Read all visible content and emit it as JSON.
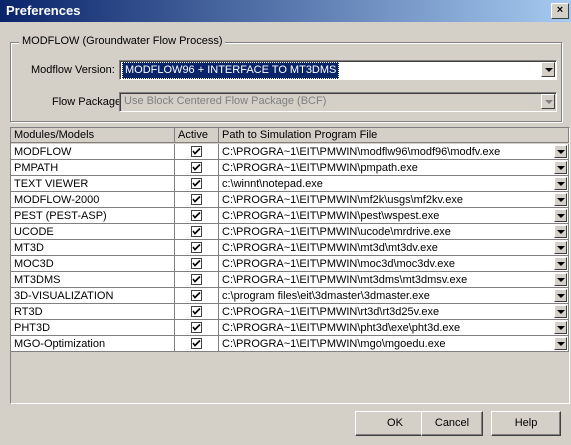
{
  "window": {
    "title": "Preferences",
    "close_label": "×"
  },
  "group": {
    "title": "MODFLOW (Groundwater Flow Process)"
  },
  "modflow_version": {
    "label": "Modflow Version:",
    "value": "MODFLOW96 + INTERFACE TO MT3DMS"
  },
  "flow_package": {
    "label": "Flow Package:",
    "value": "Use Block Centered Flow Package (BCF)"
  },
  "table": {
    "headers": [
      "Modules/Models",
      "Active",
      "Path to Simulation Program File"
    ],
    "rows": [
      {
        "name": "MODFLOW",
        "active": true,
        "path": "C:\\PROGRA~1\\EIT\\PMWIN\\modflw96\\modf96\\modfv.exe"
      },
      {
        "name": "PMPATH",
        "active": true,
        "path": "C:\\PROGRA~1\\EIT\\PMWIN\\pmpath.exe"
      },
      {
        "name": "TEXT VIEWER",
        "active": true,
        "path": "c:\\winnt\\notepad.exe"
      },
      {
        "name": "MODFLOW-2000",
        "active": true,
        "path": "C:\\PROGRA~1\\EIT\\PMWIN\\mf2k\\usgs\\mf2kv.exe"
      },
      {
        "name": "PEST (PEST-ASP)",
        "active": true,
        "path": "C:\\PROGRA~1\\EIT\\PMWIN\\pest\\wspest.exe"
      },
      {
        "name": "UCODE",
        "active": true,
        "path": "C:\\PROGRA~1\\EIT\\PMWIN\\ucode\\mrdrive.exe"
      },
      {
        "name": "MT3D",
        "active": true,
        "path": "C:\\PROGRA~1\\EIT\\PMWIN\\mt3d\\mt3dv.exe"
      },
      {
        "name": "MOC3D",
        "active": true,
        "path": "C:\\PROGRA~1\\EIT\\PMWIN\\moc3d\\moc3dv.exe"
      },
      {
        "name": "MT3DMS",
        "active": true,
        "path": "C:\\PROGRA~1\\EIT\\PMWIN\\mt3dms\\mt3dmsv.exe"
      },
      {
        "name": "3D-VISUALIZATION",
        "active": true,
        "path": "c:\\program files\\eit\\3dmaster\\3dmaster.exe"
      },
      {
        "name": "RT3D",
        "active": true,
        "path": "C:\\PROGRA~1\\EIT\\PMWIN\\rt3d\\rt3d25v.exe"
      },
      {
        "name": "PHT3D",
        "active": true,
        "path": "C:\\PROGRA~1\\EIT\\PMWIN\\pht3d\\exe\\pht3d.exe"
      },
      {
        "name": "MGO-Optimization",
        "active": true,
        "path": "C:\\PROGRA~1\\EIT\\PMWIN\\mgo\\mgoedu.exe"
      }
    ]
  },
  "buttons": {
    "ok": "OK",
    "cancel": "Cancel",
    "help": "Help"
  }
}
